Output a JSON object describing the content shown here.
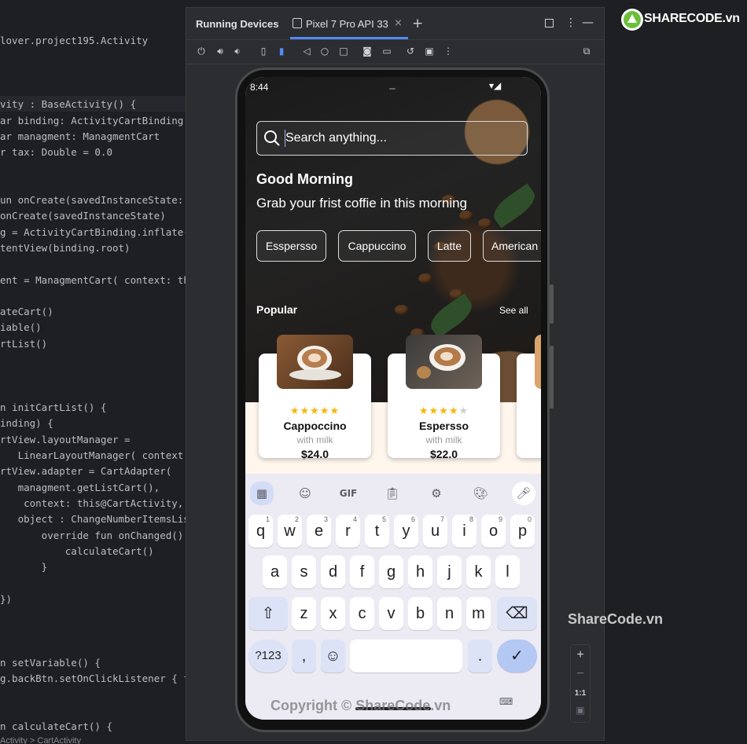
{
  "editor": {
    "lines": [
      "lover.project195.Activity",
      "vity : BaseActivity() {",
      "ar binding: ActivityCartBinding",
      "ar managment: ManagmentCart",
      "r tax: Double = 0.0",
      "un onCreate(savedInstanceState:",
      "onCreate(savedInstanceState)",
      "g = ActivityCartBinding.inflate(",
      "tentView(binding.root)",
      "ent = ManagmentCart( context: this)",
      "ateCart()",
      "iable()",
      "rtList()",
      "n initCartList() {",
      "inding) {",
      "rtView.layoutManager =",
      "   LinearLayoutManager( context: thi",
      "rtView.adapter = CartAdapter(",
      "   managment.getListCart(),",
      "    context: this@CartActivity,",
      "   object : ChangeNumberItemsList",
      "       override fun onChanged() {",
      "           calculateCart()",
      "       }",
      "})",
      "n setVariable() {",
      "g.backBtn.setOnClickListener { f",
      "n calculateCart() {"
    ],
    "breadcrumb": "Activity  >  CartActivity"
  },
  "panel": {
    "title": "Running Devices",
    "device_tab": "Pixel 7 Pro API 33"
  },
  "app": {
    "time": "8:44",
    "search_placeholder": "Search anything...",
    "greeting": "Good Morning",
    "subtitle": "Grab your frist coffie in this morning",
    "categories": [
      "Esspersso",
      "Cappuccino",
      "Latte",
      "American"
    ],
    "popular_title": "Popular",
    "see_all": "See all",
    "products": [
      {
        "name": "Cappoccino",
        "sub": "with milk",
        "price": "$24.0",
        "rating": 4.5
      },
      {
        "name": "Espersso",
        "sub": "with milk",
        "price": "$22.0",
        "rating": 4
      }
    ]
  },
  "keyboard": {
    "toolbar": [
      "apps-grid-icon",
      "sticker-icon",
      "GIF",
      "clipboard-icon",
      "settings-icon",
      "palette-icon",
      "mic-icon"
    ],
    "gif_label": "GIF",
    "row1": [
      {
        "k": "q",
        "s": "1"
      },
      {
        "k": "w",
        "s": "2"
      },
      {
        "k": "e",
        "s": "3"
      },
      {
        "k": "r",
        "s": "4"
      },
      {
        "k": "t",
        "s": "5"
      },
      {
        "k": "y",
        "s": "6"
      },
      {
        "k": "u",
        "s": "7"
      },
      {
        "k": "i",
        "s": "8"
      },
      {
        "k": "o",
        "s": "9"
      },
      {
        "k": "p",
        "s": "0"
      }
    ],
    "row2": [
      "a",
      "s",
      "d",
      "f",
      "g",
      "h",
      "j",
      "k",
      "l"
    ],
    "row3": [
      "z",
      "x",
      "c",
      "v",
      "b",
      "n",
      "m"
    ],
    "symbols": "?123",
    "comma": ",",
    "period": "."
  },
  "side_tools": {
    "zoom_in": "+",
    "zoom_out": "−",
    "ratio": "1:1"
  },
  "branding": {
    "logo_text": "SHARECODE.vn",
    "watermark": "ShareCode.vn",
    "copyright": "Copyright © ShareCode.vn"
  },
  "colors": {
    "accent_star": "#f5b50a",
    "enter_key": "#b4c8f4",
    "ide_bg": "#1e1f22"
  }
}
